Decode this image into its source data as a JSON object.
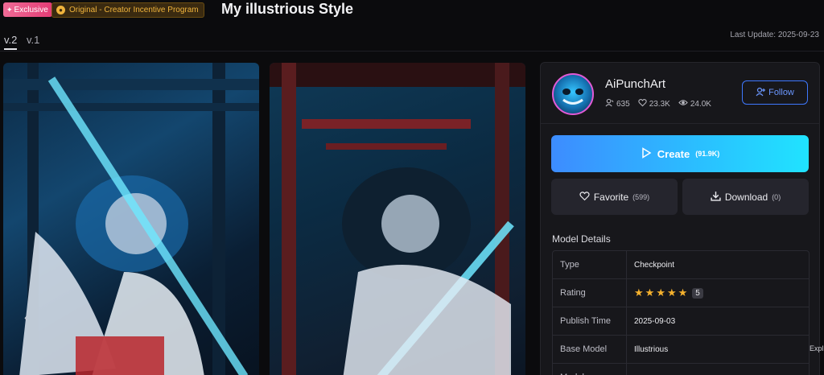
{
  "header": {
    "exclusive_badge": "Exclusive",
    "original_badge": "Original - Creator Incentive Program",
    "title": "My illustrious Style"
  },
  "versions": {
    "tabs": [
      "v.2",
      "v.1"
    ],
    "active": "v.2",
    "last_update": "Last Update:  2025-09-23"
  },
  "creator": {
    "name": "AiPunchArt",
    "followers": "635",
    "likes": "23.3K",
    "views": "24.0K",
    "follow_label": "Follow"
  },
  "actions": {
    "create_label": "Create",
    "create_count": "(91.9K)",
    "favorite_label": "Favorite",
    "favorite_count": "(599)",
    "download_label": "Download",
    "download_count": "(0)"
  },
  "model_details": {
    "title": "Model Details",
    "rows": [
      {
        "key": "Type",
        "value": "Checkpoint"
      },
      {
        "key": "Rating",
        "value": "5"
      },
      {
        "key": "Publish Time",
        "value": "2025-09-03"
      },
      {
        "key": "Base Model",
        "value": "Illustrious"
      },
      {
        "key": "Model",
        "value": ""
      }
    ],
    "rating_stars": 5
  },
  "misc": {
    "explore_fragment": "Expl"
  },
  "colors": {
    "accent_blue": "#3e78ff",
    "create_gradient_start": "#3d8cff",
    "create_gradient_end": "#20e3ff",
    "exclusive_pink": "#e23c75",
    "original_gold": "#f0b43c",
    "star_color": "#f5b12e"
  },
  "icons": {
    "exclusive": "sparkle-icon",
    "original": "coin-icon",
    "followers": "user-follow-icon",
    "likes": "heart-icon",
    "views": "eye-icon",
    "follow": "user-plus-icon",
    "create": "play-icon",
    "favorite": "heart-icon",
    "download": "download-icon",
    "carousel_prev": "chevron-left-icon"
  }
}
